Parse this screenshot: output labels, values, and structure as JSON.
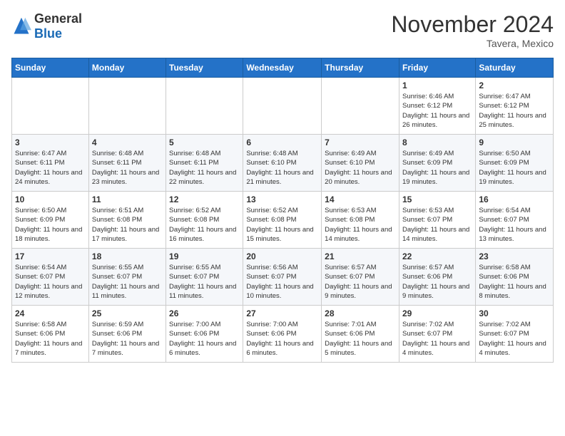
{
  "logo": {
    "general": "General",
    "blue": "Blue"
  },
  "header": {
    "month": "November 2024",
    "location": "Tavera, Mexico"
  },
  "weekdays": [
    "Sunday",
    "Monday",
    "Tuesday",
    "Wednesday",
    "Thursday",
    "Friday",
    "Saturday"
  ],
  "weeks": [
    [
      {
        "day": "",
        "info": ""
      },
      {
        "day": "",
        "info": ""
      },
      {
        "day": "",
        "info": ""
      },
      {
        "day": "",
        "info": ""
      },
      {
        "day": "",
        "info": ""
      },
      {
        "day": "1",
        "info": "Sunrise: 6:46 AM\nSunset: 6:12 PM\nDaylight: 11 hours and 26 minutes."
      },
      {
        "day": "2",
        "info": "Sunrise: 6:47 AM\nSunset: 6:12 PM\nDaylight: 11 hours and 25 minutes."
      }
    ],
    [
      {
        "day": "3",
        "info": "Sunrise: 6:47 AM\nSunset: 6:11 PM\nDaylight: 11 hours and 24 minutes."
      },
      {
        "day": "4",
        "info": "Sunrise: 6:48 AM\nSunset: 6:11 PM\nDaylight: 11 hours and 23 minutes."
      },
      {
        "day": "5",
        "info": "Sunrise: 6:48 AM\nSunset: 6:11 PM\nDaylight: 11 hours and 22 minutes."
      },
      {
        "day": "6",
        "info": "Sunrise: 6:48 AM\nSunset: 6:10 PM\nDaylight: 11 hours and 21 minutes."
      },
      {
        "day": "7",
        "info": "Sunrise: 6:49 AM\nSunset: 6:10 PM\nDaylight: 11 hours and 20 minutes."
      },
      {
        "day": "8",
        "info": "Sunrise: 6:49 AM\nSunset: 6:09 PM\nDaylight: 11 hours and 19 minutes."
      },
      {
        "day": "9",
        "info": "Sunrise: 6:50 AM\nSunset: 6:09 PM\nDaylight: 11 hours and 19 minutes."
      }
    ],
    [
      {
        "day": "10",
        "info": "Sunrise: 6:50 AM\nSunset: 6:09 PM\nDaylight: 11 hours and 18 minutes."
      },
      {
        "day": "11",
        "info": "Sunrise: 6:51 AM\nSunset: 6:08 PM\nDaylight: 11 hours and 17 minutes."
      },
      {
        "day": "12",
        "info": "Sunrise: 6:52 AM\nSunset: 6:08 PM\nDaylight: 11 hours and 16 minutes."
      },
      {
        "day": "13",
        "info": "Sunrise: 6:52 AM\nSunset: 6:08 PM\nDaylight: 11 hours and 15 minutes."
      },
      {
        "day": "14",
        "info": "Sunrise: 6:53 AM\nSunset: 6:08 PM\nDaylight: 11 hours and 14 minutes."
      },
      {
        "day": "15",
        "info": "Sunrise: 6:53 AM\nSunset: 6:07 PM\nDaylight: 11 hours and 14 minutes."
      },
      {
        "day": "16",
        "info": "Sunrise: 6:54 AM\nSunset: 6:07 PM\nDaylight: 11 hours and 13 minutes."
      }
    ],
    [
      {
        "day": "17",
        "info": "Sunrise: 6:54 AM\nSunset: 6:07 PM\nDaylight: 11 hours and 12 minutes."
      },
      {
        "day": "18",
        "info": "Sunrise: 6:55 AM\nSunset: 6:07 PM\nDaylight: 11 hours and 11 minutes."
      },
      {
        "day": "19",
        "info": "Sunrise: 6:55 AM\nSunset: 6:07 PM\nDaylight: 11 hours and 11 minutes."
      },
      {
        "day": "20",
        "info": "Sunrise: 6:56 AM\nSunset: 6:07 PM\nDaylight: 11 hours and 10 minutes."
      },
      {
        "day": "21",
        "info": "Sunrise: 6:57 AM\nSunset: 6:07 PM\nDaylight: 11 hours and 9 minutes."
      },
      {
        "day": "22",
        "info": "Sunrise: 6:57 AM\nSunset: 6:06 PM\nDaylight: 11 hours and 9 minutes."
      },
      {
        "day": "23",
        "info": "Sunrise: 6:58 AM\nSunset: 6:06 PM\nDaylight: 11 hours and 8 minutes."
      }
    ],
    [
      {
        "day": "24",
        "info": "Sunrise: 6:58 AM\nSunset: 6:06 PM\nDaylight: 11 hours and 7 minutes."
      },
      {
        "day": "25",
        "info": "Sunrise: 6:59 AM\nSunset: 6:06 PM\nDaylight: 11 hours and 7 minutes."
      },
      {
        "day": "26",
        "info": "Sunrise: 7:00 AM\nSunset: 6:06 PM\nDaylight: 11 hours and 6 minutes."
      },
      {
        "day": "27",
        "info": "Sunrise: 7:00 AM\nSunset: 6:06 PM\nDaylight: 11 hours and 6 minutes."
      },
      {
        "day": "28",
        "info": "Sunrise: 7:01 AM\nSunset: 6:06 PM\nDaylight: 11 hours and 5 minutes."
      },
      {
        "day": "29",
        "info": "Sunrise: 7:02 AM\nSunset: 6:07 PM\nDaylight: 11 hours and 4 minutes."
      },
      {
        "day": "30",
        "info": "Sunrise: 7:02 AM\nSunset: 6:07 PM\nDaylight: 11 hours and 4 minutes."
      }
    ]
  ]
}
